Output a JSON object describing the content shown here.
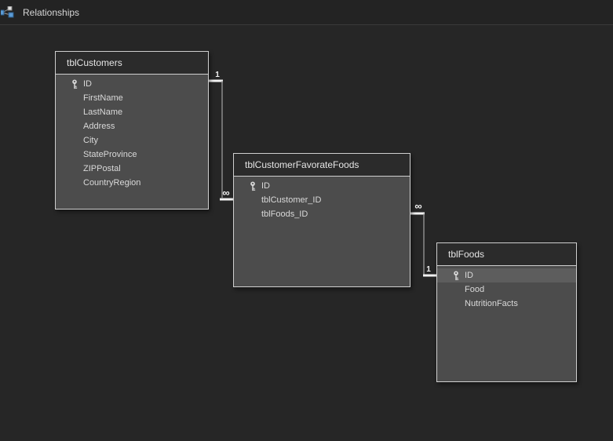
{
  "app": {
    "tab_title": "Relationships"
  },
  "tables": [
    {
      "name": "tblCustomers",
      "fields": [
        {
          "name": "ID",
          "key": true
        },
        {
          "name": "FirstName",
          "key": false
        },
        {
          "name": "LastName",
          "key": false
        },
        {
          "name": "Address",
          "key": false
        },
        {
          "name": "City",
          "key": false
        },
        {
          "name": "StateProvince",
          "key": false
        },
        {
          "name": "ZIPPostal",
          "key": false
        },
        {
          "name": "CountryRegion",
          "key": false
        }
      ]
    },
    {
      "name": "tblCustomerFavorateFoods",
      "fields": [
        {
          "name": "ID",
          "key": true
        },
        {
          "name": "tblCustomer_ID",
          "key": false
        },
        {
          "name": "tblFoods_ID",
          "key": false
        }
      ]
    },
    {
      "name": "tblFoods",
      "fields": [
        {
          "name": "ID",
          "key": true,
          "highlighted": true
        },
        {
          "name": "Food",
          "key": false
        },
        {
          "name": "NutritionFacts",
          "key": false
        }
      ]
    }
  ],
  "relationships": [
    {
      "from": "tblCustomers",
      "to": "tblCustomerFavorateFoods",
      "from_cardinality": "1",
      "to_cardinality": "∞"
    },
    {
      "from": "tblCustomerFavorateFoods",
      "to": "tblFoods",
      "from_cardinality": "∞",
      "to_cardinality": "1"
    }
  ],
  "colors": {
    "canvas_bg": "#262626",
    "tab_bar_bg": "#232323",
    "table_body": "#4c4c4c",
    "table_header_bg": "#2b2b2b",
    "table_border": "#cfcfcf",
    "highlight_row": "#5d5d5d",
    "join_line": "#9a9a9a",
    "join_line_end": "#f2f2f2",
    "icon_blue": "#5b9bd5"
  }
}
